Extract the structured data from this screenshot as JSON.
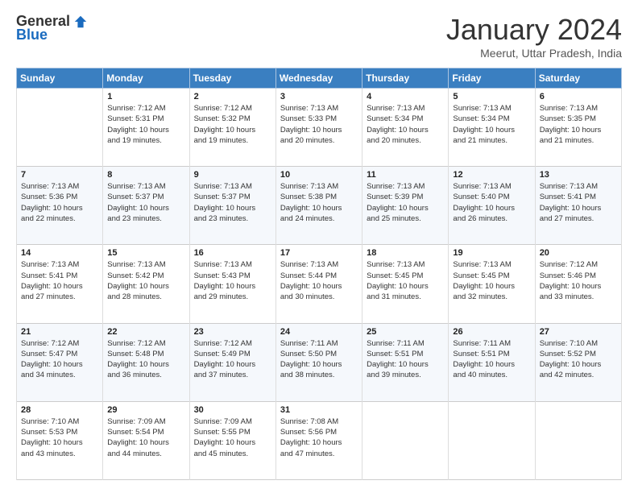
{
  "header": {
    "logo_general": "General",
    "logo_blue": "Blue",
    "month_title": "January 2024",
    "location": "Meerut, Uttar Pradesh, India"
  },
  "weekdays": [
    "Sunday",
    "Monday",
    "Tuesday",
    "Wednesday",
    "Thursday",
    "Friday",
    "Saturday"
  ],
  "weeks": [
    [
      {
        "day": "",
        "info": ""
      },
      {
        "day": "1",
        "info": "Sunrise: 7:12 AM\nSunset: 5:31 PM\nDaylight: 10 hours\nand 19 minutes."
      },
      {
        "day": "2",
        "info": "Sunrise: 7:12 AM\nSunset: 5:32 PM\nDaylight: 10 hours\nand 19 minutes."
      },
      {
        "day": "3",
        "info": "Sunrise: 7:13 AM\nSunset: 5:33 PM\nDaylight: 10 hours\nand 20 minutes."
      },
      {
        "day": "4",
        "info": "Sunrise: 7:13 AM\nSunset: 5:34 PM\nDaylight: 10 hours\nand 20 minutes."
      },
      {
        "day": "5",
        "info": "Sunrise: 7:13 AM\nSunset: 5:34 PM\nDaylight: 10 hours\nand 21 minutes."
      },
      {
        "day": "6",
        "info": "Sunrise: 7:13 AM\nSunset: 5:35 PM\nDaylight: 10 hours\nand 21 minutes."
      }
    ],
    [
      {
        "day": "7",
        "info": "Sunrise: 7:13 AM\nSunset: 5:36 PM\nDaylight: 10 hours\nand 22 minutes."
      },
      {
        "day": "8",
        "info": "Sunrise: 7:13 AM\nSunset: 5:37 PM\nDaylight: 10 hours\nand 23 minutes."
      },
      {
        "day": "9",
        "info": "Sunrise: 7:13 AM\nSunset: 5:37 PM\nDaylight: 10 hours\nand 23 minutes."
      },
      {
        "day": "10",
        "info": "Sunrise: 7:13 AM\nSunset: 5:38 PM\nDaylight: 10 hours\nand 24 minutes."
      },
      {
        "day": "11",
        "info": "Sunrise: 7:13 AM\nSunset: 5:39 PM\nDaylight: 10 hours\nand 25 minutes."
      },
      {
        "day": "12",
        "info": "Sunrise: 7:13 AM\nSunset: 5:40 PM\nDaylight: 10 hours\nand 26 minutes."
      },
      {
        "day": "13",
        "info": "Sunrise: 7:13 AM\nSunset: 5:41 PM\nDaylight: 10 hours\nand 27 minutes."
      }
    ],
    [
      {
        "day": "14",
        "info": "Sunrise: 7:13 AM\nSunset: 5:41 PM\nDaylight: 10 hours\nand 27 minutes."
      },
      {
        "day": "15",
        "info": "Sunrise: 7:13 AM\nSunset: 5:42 PM\nDaylight: 10 hours\nand 28 minutes."
      },
      {
        "day": "16",
        "info": "Sunrise: 7:13 AM\nSunset: 5:43 PM\nDaylight: 10 hours\nand 29 minutes."
      },
      {
        "day": "17",
        "info": "Sunrise: 7:13 AM\nSunset: 5:44 PM\nDaylight: 10 hours\nand 30 minutes."
      },
      {
        "day": "18",
        "info": "Sunrise: 7:13 AM\nSunset: 5:45 PM\nDaylight: 10 hours\nand 31 minutes."
      },
      {
        "day": "19",
        "info": "Sunrise: 7:13 AM\nSunset: 5:45 PM\nDaylight: 10 hours\nand 32 minutes."
      },
      {
        "day": "20",
        "info": "Sunrise: 7:12 AM\nSunset: 5:46 PM\nDaylight: 10 hours\nand 33 minutes."
      }
    ],
    [
      {
        "day": "21",
        "info": "Sunrise: 7:12 AM\nSunset: 5:47 PM\nDaylight: 10 hours\nand 34 minutes."
      },
      {
        "day": "22",
        "info": "Sunrise: 7:12 AM\nSunset: 5:48 PM\nDaylight: 10 hours\nand 36 minutes."
      },
      {
        "day": "23",
        "info": "Sunrise: 7:12 AM\nSunset: 5:49 PM\nDaylight: 10 hours\nand 37 minutes."
      },
      {
        "day": "24",
        "info": "Sunrise: 7:11 AM\nSunset: 5:50 PM\nDaylight: 10 hours\nand 38 minutes."
      },
      {
        "day": "25",
        "info": "Sunrise: 7:11 AM\nSunset: 5:51 PM\nDaylight: 10 hours\nand 39 minutes."
      },
      {
        "day": "26",
        "info": "Sunrise: 7:11 AM\nSunset: 5:51 PM\nDaylight: 10 hours\nand 40 minutes."
      },
      {
        "day": "27",
        "info": "Sunrise: 7:10 AM\nSunset: 5:52 PM\nDaylight: 10 hours\nand 42 minutes."
      }
    ],
    [
      {
        "day": "28",
        "info": "Sunrise: 7:10 AM\nSunset: 5:53 PM\nDaylight: 10 hours\nand 43 minutes."
      },
      {
        "day": "29",
        "info": "Sunrise: 7:09 AM\nSunset: 5:54 PM\nDaylight: 10 hours\nand 44 minutes."
      },
      {
        "day": "30",
        "info": "Sunrise: 7:09 AM\nSunset: 5:55 PM\nDaylight: 10 hours\nand 45 minutes."
      },
      {
        "day": "31",
        "info": "Sunrise: 7:08 AM\nSunset: 5:56 PM\nDaylight: 10 hours\nand 47 minutes."
      },
      {
        "day": "",
        "info": ""
      },
      {
        "day": "",
        "info": ""
      },
      {
        "day": "",
        "info": ""
      }
    ]
  ]
}
